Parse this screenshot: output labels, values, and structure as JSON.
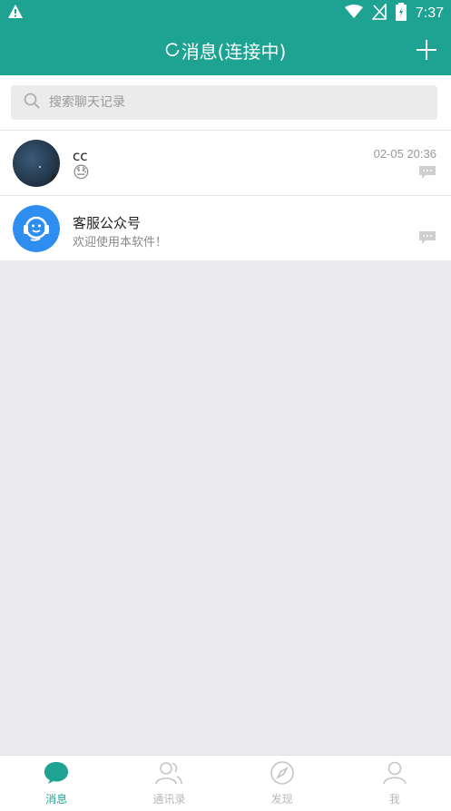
{
  "status_bar": {
    "time": "7:37"
  },
  "header": {
    "title": "消息(连接中)"
  },
  "search": {
    "placeholder": "搜索聊天记录"
  },
  "conversations": [
    {
      "name": "cc",
      "preview": "😓",
      "time": "02-05 20:36"
    },
    {
      "name": "客服公众号",
      "preview": "欢迎使用本软件！",
      "time": ""
    }
  ],
  "tabs": [
    {
      "label": "消息",
      "icon": "chat-bubble-icon",
      "active": true
    },
    {
      "label": "通讯录",
      "icon": "contacts-icon",
      "active": false
    },
    {
      "label": "发现",
      "icon": "compass-icon",
      "active": false
    },
    {
      "label": "我",
      "icon": "person-icon",
      "active": false
    }
  ],
  "colors": {
    "accent": "#1ea393",
    "background": "#ebebf0"
  }
}
